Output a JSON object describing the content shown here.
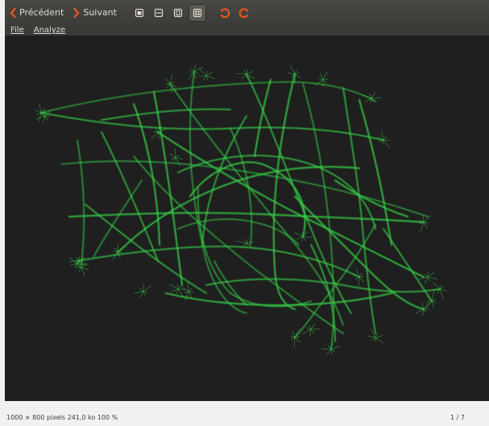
{
  "toolbar": {
    "prev_label": "Précédent",
    "next_label": "Suivant",
    "icons": [
      "window-icon",
      "fullscreen-icon",
      "copy-icon",
      "grid-icon"
    ],
    "rotate_left_icon": "rotate-left-icon",
    "rotate_right_icon": "rotate-right-icon",
    "accent": "#e95420"
  },
  "menubar": {
    "items": [
      "File",
      "Analyze"
    ]
  },
  "viewer": {
    "background": "#1f1f1f",
    "stroke_color": "#39d84a"
  },
  "statusbar": {
    "info": "1000 × 800 pixels  241,0 ko  100 %",
    "page": "1 / 7"
  }
}
